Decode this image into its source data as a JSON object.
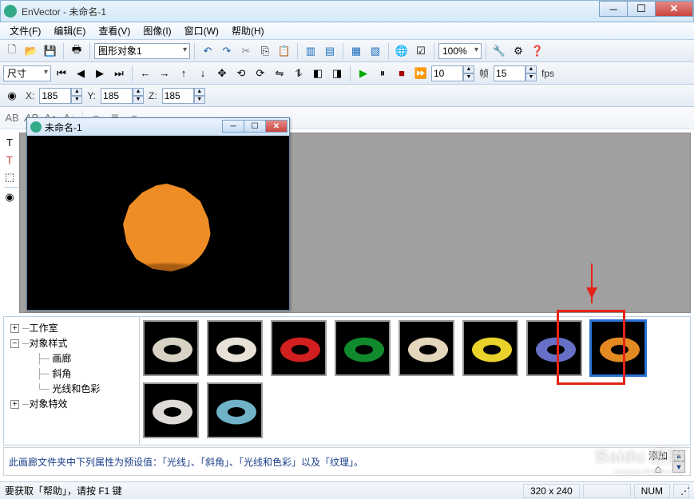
{
  "window": {
    "title": "EnVector - 未命名-1"
  },
  "menu": [
    "文件(F)",
    "编辑(E)",
    "查看(V)",
    "图像(I)",
    "窗口(W)",
    "帮助(H)"
  ],
  "toolbar1": {
    "objectCombo": "图形对象1",
    "zoom": "100%"
  },
  "toolbar2": {
    "sizeCombo": "尺寸",
    "spin1": "10",
    "frameLabel": "帧",
    "spin2": "15",
    "fpsLabel": "fps"
  },
  "coords": {
    "xLabel": "X:",
    "x": "185",
    "yLabel": "Y:",
    "y": "185",
    "zLabel": "Z:",
    "z": "185"
  },
  "childWindow": {
    "title": "未命名-1"
  },
  "tree": {
    "n1": "工作室",
    "n2": "对象样式",
    "n2a": "画廊",
    "n2b": "斜角",
    "n2c": "光线和色彩",
    "n3": "对象特效"
  },
  "gallery": {
    "colors": [
      "#d8d2c4",
      "#e7e1d7",
      "#d11f1f",
      "#108a2c",
      "#e4d6bc",
      "#e9d22a",
      "#6670c7",
      "#e38a23",
      "#dedad5",
      "#70b3c9"
    ],
    "selectedIndex": 7
  },
  "info": {
    "text": "此画廊文件夹中下列属性为预设值：「光线」、「斜角」、「光线和色彩」以及「纹理」。",
    "add": "添加"
  },
  "status": {
    "help": "要获取「帮助」，请按 F1 键",
    "dim": "320 x 240",
    "num": "NUM"
  },
  "watermark": {
    "main": "Baidu 经验",
    "sub": "jingyan.baidu.com"
  }
}
